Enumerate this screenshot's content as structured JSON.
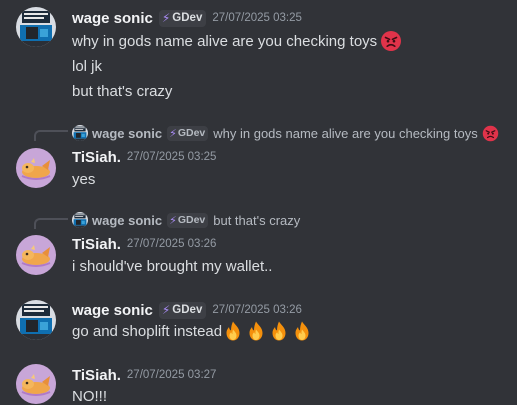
{
  "messages": [
    {
      "author": "wage sonic",
      "tag": "GDev",
      "timestamp": "27/07/2025 03:25",
      "lines": [
        "why in gods name alive are you checking toys",
        "lol jk",
        "but that's crazy"
      ],
      "emoji": "angry-face"
    },
    {
      "reply": {
        "author": "wage sonic",
        "tag": "GDev",
        "text": "why in gods name alive are you checking toys"
      },
      "author": "TiSiah.",
      "timestamp": "27/07/2025 03:25",
      "lines": [
        "yes"
      ]
    },
    {
      "reply": {
        "author": "wage sonic",
        "tag": "GDev",
        "text": "but that's crazy"
      },
      "author": "TiSiah.",
      "timestamp": "27/07/2025 03:26",
      "lines": [
        "i should've brought my wallet.."
      ]
    },
    {
      "author": "wage sonic",
      "tag": "GDev",
      "timestamp": "27/07/2025 03:26",
      "lines": [
        "go and shoplift instead"
      ],
      "emoji": "fire",
      "emoji_count": 4
    },
    {
      "author": "TiSiah.",
      "timestamp": "27/07/2025 03:27",
      "lines": [
        "NO!!!"
      ]
    }
  ],
  "colors": {
    "background": "#313338",
    "text": "#dbdee1",
    "username": "#f2f3f5",
    "muted": "#949ba4",
    "tag_bolt": "#a98bf5"
  },
  "icons": {
    "tag_icon": "lightning-bolt-icon",
    "tag_glyph": "⚡"
  }
}
